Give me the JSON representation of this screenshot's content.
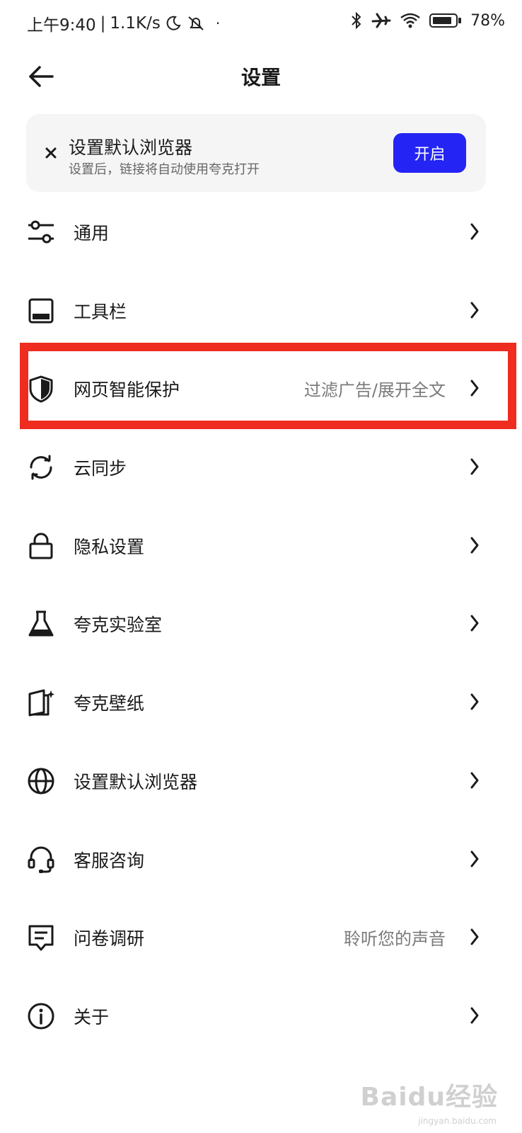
{
  "status_bar": {
    "time": "上午9:40",
    "speed": "1.1K/s",
    "battery": "78%"
  },
  "header": {
    "title": "设置"
  },
  "banner": {
    "title": "设置默认浏览器",
    "subtitle": "设置后，链接将自动使用夸克打开",
    "button_label": "开启"
  },
  "menu": [
    {
      "label": "通用",
      "value": "",
      "icon": "sliders-icon"
    },
    {
      "label": "工具栏",
      "value": "",
      "icon": "toolbar-icon"
    },
    {
      "label": "网页智能保护",
      "value": "过滤广告/展开全文",
      "icon": "shield-icon"
    },
    {
      "label": "云同步",
      "value": "",
      "icon": "sync-icon"
    },
    {
      "label": "隐私设置",
      "value": "",
      "icon": "lock-icon"
    },
    {
      "label": "夸克实验室",
      "value": "",
      "icon": "flask-icon"
    },
    {
      "label": "夸克壁纸",
      "value": "",
      "icon": "wallpaper-icon"
    },
    {
      "label": "设置默认浏览器",
      "value": "",
      "icon": "globe-icon"
    },
    {
      "label": "客服咨询",
      "value": "",
      "icon": "headset-icon"
    },
    {
      "label": "问卷调研",
      "value": "聆听您的声音",
      "icon": "survey-icon"
    },
    {
      "label": "关于",
      "value": "",
      "icon": "info-icon"
    }
  ],
  "colors": {
    "accent": "#2424f5",
    "highlight": "#ee2c1f",
    "banner_bg": "#f5f5f5"
  },
  "watermark": {
    "text": "Baidu经验",
    "sub": "jingyan.baidu.com"
  }
}
